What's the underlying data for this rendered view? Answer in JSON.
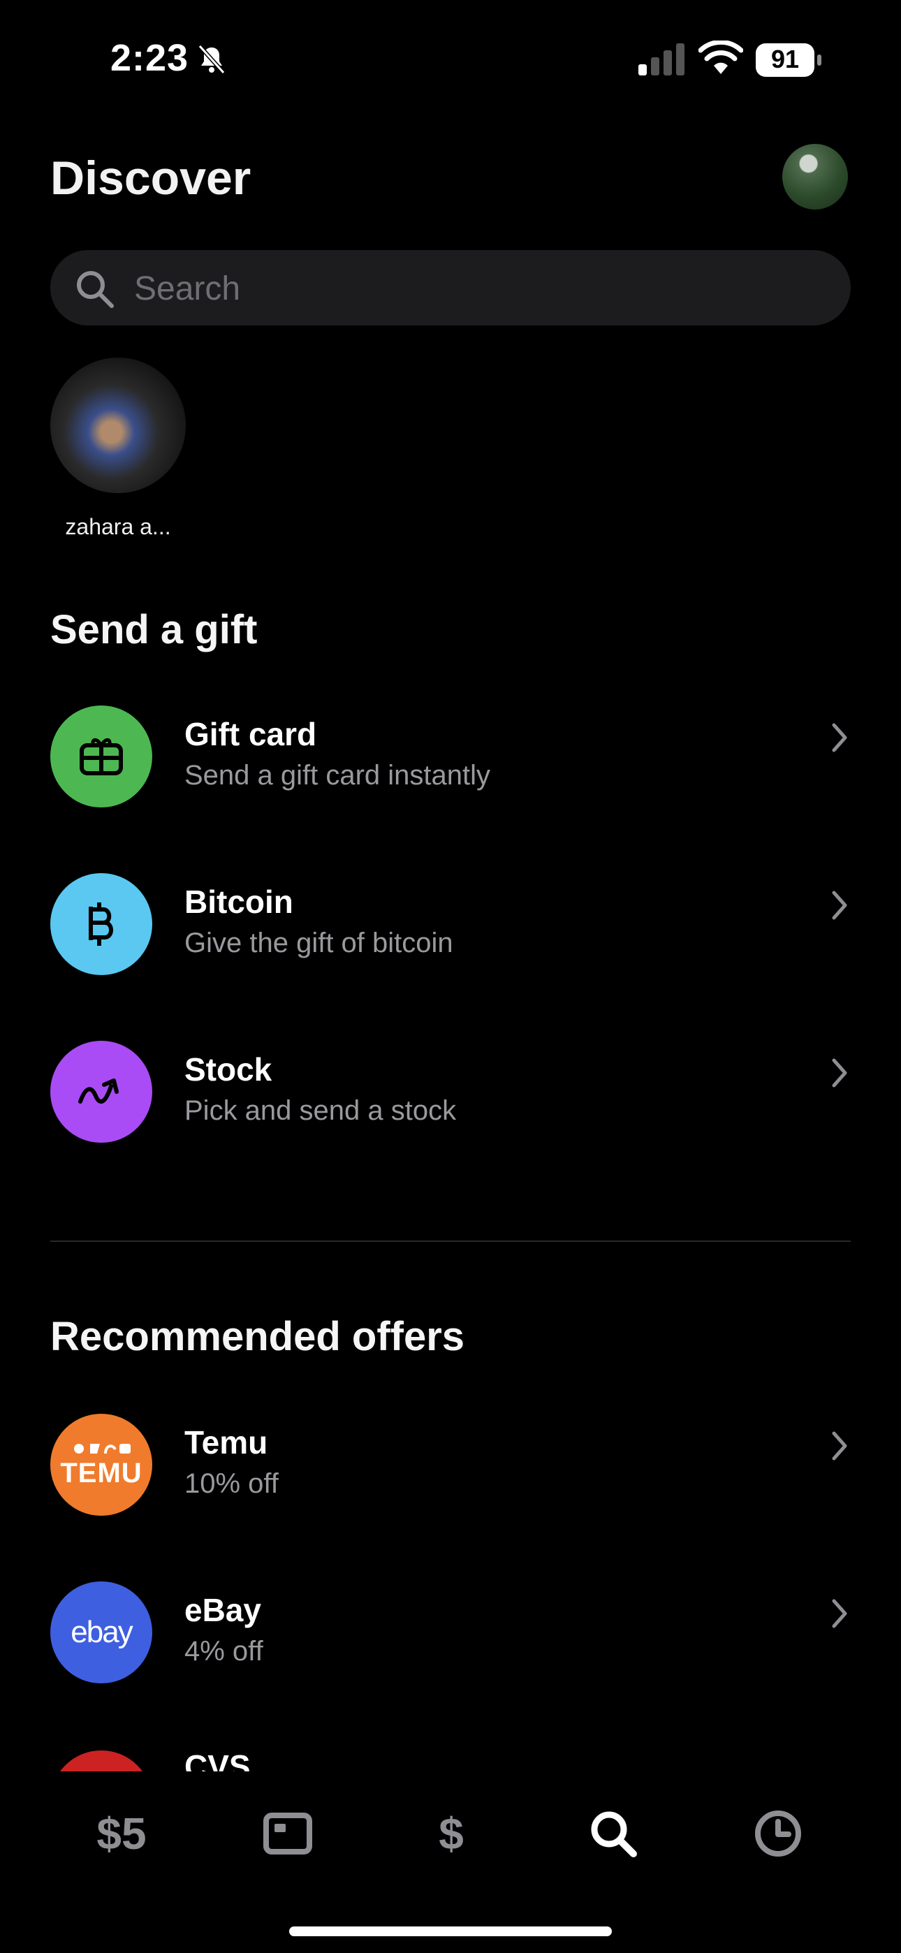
{
  "status_bar": {
    "time": "2:23",
    "battery": "91"
  },
  "header": {
    "title": "Discover"
  },
  "search": {
    "placeholder": "Search"
  },
  "contacts": [
    {
      "name": "zahara a..."
    }
  ],
  "send_gift": {
    "title": "Send a gift",
    "items": [
      {
        "title": "Gift card",
        "subtitle": "Send a gift card instantly",
        "icon": "gift-icon",
        "color": "#4db851"
      },
      {
        "title": "Bitcoin",
        "subtitle": "Give the gift of bitcoin",
        "icon": "bitcoin-icon",
        "color": "#5ac8f0"
      },
      {
        "title": "Stock",
        "subtitle": "Pick and send a stock",
        "icon": "stock-trend-icon",
        "color": "#a94cf5"
      }
    ]
  },
  "offers": {
    "title": "Recommended offers",
    "items": [
      {
        "title": "Temu",
        "subtitle": "10% off",
        "logo_text": "TEMU",
        "color": "#f07b2c"
      },
      {
        "title": "eBay",
        "subtitle": "4% off",
        "logo_text": "ebay",
        "color": "#3e5fe0"
      },
      {
        "title": "CVS",
        "color": "#cc2222"
      }
    ]
  },
  "tabs": [
    {
      "label": "$5",
      "icon": "balance-tab"
    },
    {
      "label": "",
      "icon": "card-icon"
    },
    {
      "label": "$",
      "icon": "dollar-icon"
    },
    {
      "label": "",
      "icon": "search-icon",
      "active": true
    },
    {
      "label": "",
      "icon": "clock-icon"
    }
  ],
  "colors": {
    "background": "#000000",
    "muted_text": "#9a9a9e",
    "active_tab": "#ffffff",
    "inactive_tab": "#8e8e93"
  }
}
